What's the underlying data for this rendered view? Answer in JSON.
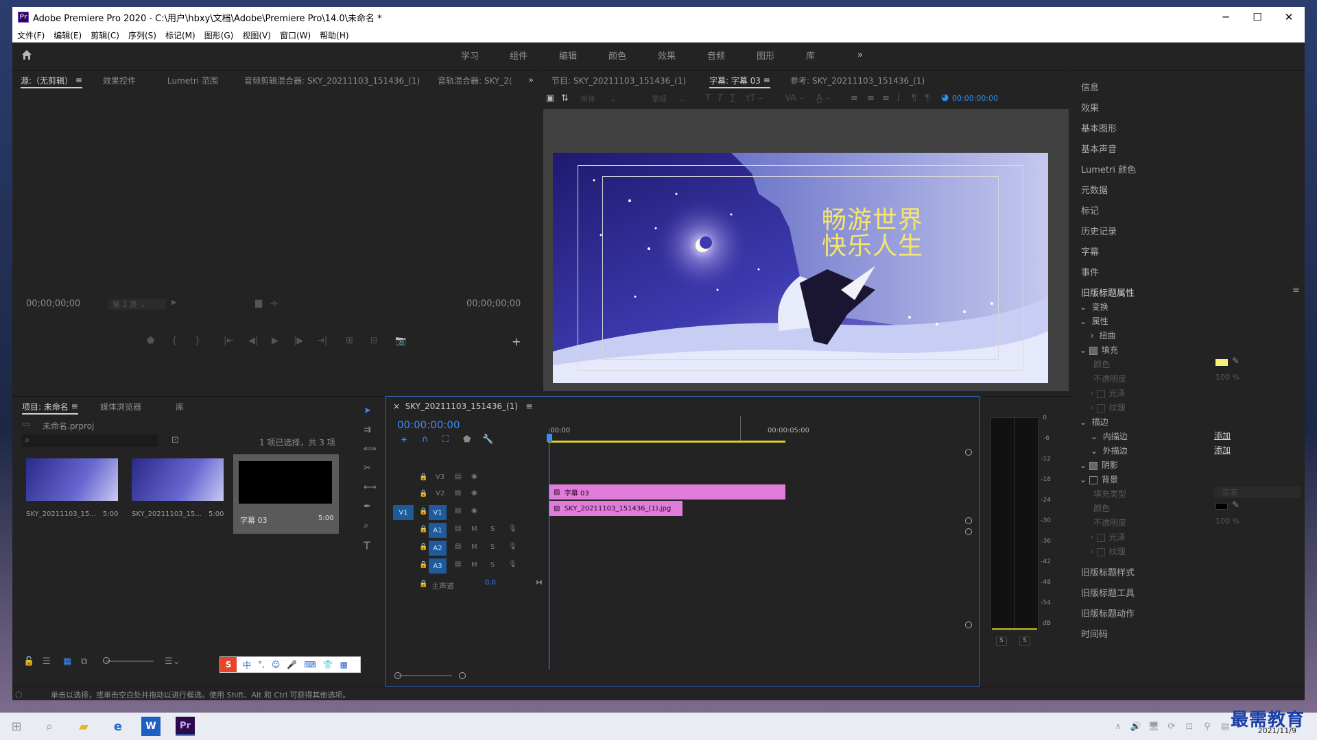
{
  "window": {
    "title": "Adobe Premiere Pro 2020 - C:\\用户\\hbxy\\文档\\Adobe\\Premiere Pro\\14.0\\未命名 *",
    "app_badge": "Pr",
    "minimize": "─",
    "maximize": "☐",
    "close": "✕"
  },
  "menu": [
    "文件(F)",
    "编辑(E)",
    "剪辑(C)",
    "序列(S)",
    "标记(M)",
    "图形(G)",
    "视图(V)",
    "窗口(W)",
    "帮助(H)"
  ],
  "workspaces": [
    "学习",
    "组件",
    "编辑",
    "颜色",
    "效果",
    "音频",
    "图形",
    "库"
  ],
  "source_panel": {
    "tabs": [
      "源:（无剪辑）",
      "效果控件",
      "Lumetri 范围",
      "音频剪辑混合器: SKY_20211103_151436_(1)",
      "音轨混合器: SKY_2("
    ],
    "timecode_left": "00;00;00;00",
    "page": "第 1 页",
    "timecode_right": "00;00;00;00"
  },
  "program_panel": {
    "tabs": [
      "节目: SKY_20211103_151436_(1)",
      "字幕: 字幕 03",
      "参考: SKY_20211103_151436_(1)"
    ],
    "font_family": "宋体",
    "font_style": "常规",
    "timecode": "00:00:00:00",
    "title_line1": "畅游世界",
    "title_line2": "快乐人生",
    "title_color": "#f5e66b"
  },
  "right_panel": {
    "items": [
      "信息",
      "效果",
      "基本图形",
      "基本声音",
      "Lumetri 颜色",
      "元数据",
      "标记",
      "历史记录",
      "字幕",
      "事件"
    ],
    "props_header": "旧版标题属性",
    "props": {
      "transform": "变换",
      "attributes": "属性",
      "distort": "扭曲",
      "fill": "填充",
      "color_label": "颜色",
      "fill_color": "#f5f07a",
      "opacity_label": "不透明度",
      "opacity_value": "100 %",
      "sheen": "光泽",
      "texture": "纹理",
      "stroke": "描边",
      "inner_stroke": "内描边",
      "outer_stroke": "外描边",
      "add": "添加",
      "shadow": "阴影",
      "background": "背景",
      "fill_type_label": "填充类型",
      "fill_type_value": "实底",
      "bg_color": "#000000",
      "bg_opacity_value": "100 %"
    },
    "bottom_items": [
      "旧版标题样式",
      "旧版标题工具",
      "旧版标题动作",
      "时间码"
    ]
  },
  "project_panel": {
    "tabs": [
      "项目: 未命名",
      "媒体浏览器",
      "库"
    ],
    "file": "未命名.prproj",
    "selection_info": "1 项已选择，共 3 项",
    "items": [
      {
        "name": "SKY_20211103_15...",
        "duration": "5:00"
      },
      {
        "name": "SKY_20211103_15...",
        "duration": "5:00"
      },
      {
        "name": "字幕 03",
        "duration": "5:00"
      }
    ]
  },
  "timeline": {
    "tab": "SKY_20211103_151436_(1)",
    "timecode": "00:00:00:00",
    "ruler": [
      ":00:00",
      "00:00:05:00"
    ],
    "tracks_video": [
      "V3",
      "V2",
      "V1"
    ],
    "tracks_audio": [
      "A1",
      "A2",
      "A3"
    ],
    "source_patch": "V1",
    "master": "主声道",
    "master_value": "0.0",
    "clip_title": "字幕 03",
    "clip_image": "SKY_20211103_151436_(1).jpg",
    "mute": "M",
    "solo": "S"
  },
  "meter": {
    "ticks": [
      "0",
      "-6",
      "-12",
      "-18",
      "-24",
      "-30",
      "-36",
      "-42",
      "-48",
      "-54",
      "dB"
    ],
    "solo": [
      "S",
      "S"
    ]
  },
  "statusbar": {
    "text": "单击以选择，或单击空白处并拖动以进行框选。使用 Shift、Alt 和 Ctrl 可获得其他选项。"
  },
  "ime": {
    "items": [
      "中",
      "°,",
      "☺",
      "🎤",
      "⌨",
      "👕",
      "▦"
    ]
  },
  "taskbar": {
    "date": "2021/11/9",
    "watermark": "最需教育"
  }
}
